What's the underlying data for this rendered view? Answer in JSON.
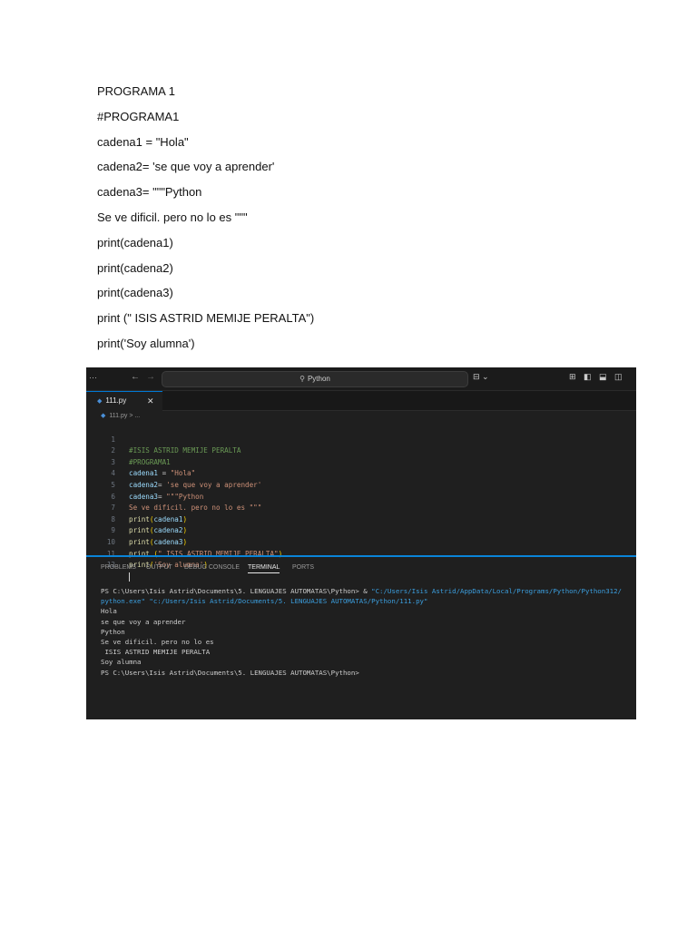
{
  "document": {
    "lines": [
      "PROGRAMA 1",
      "#PROGRAMA1",
      "cadena1 = \"Hola\"",
      "cadena2= 'se que voy a aprender'",
      "cadena3= \"\"\"Python",
      "Se ve dificil. pero no lo es \"\"\"",
      "print(cadena1)",
      "print(cadena2)",
      "print(cadena3)",
      "print (\" ISIS ASTRID MEMIJE PERALTA\")",
      "print('Soy alumna')"
    ]
  },
  "vscode": {
    "titlebar": {
      "more_icon": "···",
      "search_text": "Python",
      "copilot_label": "⊟ ⌄",
      "layout_icons": "⊞ ◧ ⬓ ◫"
    },
    "tab": {
      "label": "111.py",
      "close": "✕"
    },
    "breadcrumb": "111.py > ...",
    "editor": {
      "line_numbers": [
        "1",
        "2",
        "3",
        "4",
        "5",
        "6",
        "7",
        "8",
        "9",
        "10",
        "11",
        "12"
      ],
      "lines": {
        "l1": "#ISIS ASTRID MEMIJE PERALTA",
        "l2": "#PROGRAMA1",
        "l3_id": "cadena1",
        "l3_op": " = ",
        "l3_str": "\"Hola\"",
        "l4_id": "cadena2",
        "l4_op": "= ",
        "l4_str": "'se que voy a aprender'",
        "l5_id": "cadena3",
        "l5_op": "= ",
        "l5_str": "\"\"\"Python",
        "l6_str": "Se ve dificil. pero no lo es \"\"\"",
        "l7_fn": "print",
        "l7_open": "(",
        "l7_arg": "cadena1",
        "l7_close": ")",
        "l8_fn": "print",
        "l8_open": "(",
        "l8_arg": "cadena2",
        "l8_close": ")",
        "l9_fn": "print",
        "l9_open": "(",
        "l9_arg": "cadena3",
        "l9_close": ")",
        "l10_fn": "print",
        "l10_open": " (",
        "l10_str": "\" ISIS ASTRID MEMIJE PERALTA\"",
        "l10_close": ")",
        "l11_fn": "print",
        "l11_open": "(",
        "l11_str": "'Soy alumna'",
        "l11_close": ")"
      }
    },
    "panel_tabs": [
      "PROBLEMS",
      "OUTPUT",
      "DEBUG CONSOLE",
      "TERMINAL",
      "PORTS"
    ],
    "active_panel_tab": "TERMINAL",
    "terminal": {
      "prompt_cmd": "PS C:\\Users\\Isis Astrid\\Documents\\5. LENGUAJES AUTOMATAS\\Python> & ",
      "cmd_path1": "\"C:/Users/Isis Astrid/AppData/Local/Programs/Python/Python312/",
      "cmd_path2": "python.exe\" \"c:/Users/Isis Astrid/Documents/5. LENGUAJES AUTOMATAS/Python/111.py\"",
      "output": [
        "Hola",
        "se que voy a aprender",
        "Python",
        "Se ve dificil. pero no lo es",
        " ISIS ASTRID MEMIJE PERALTA",
        "Soy alumna",
        "PS C:\\Users\\Isis Astrid\\Documents\\5. LENGUAJES AUTOMATAS\\Python>"
      ]
    },
    "colors": {
      "editor_bg": "#1f1f1f",
      "accent": "#0078d4",
      "comment": "#6a9955",
      "string": "#ce9178",
      "function": "#dcdcaa",
      "variable": "#9cdcfe"
    }
  }
}
